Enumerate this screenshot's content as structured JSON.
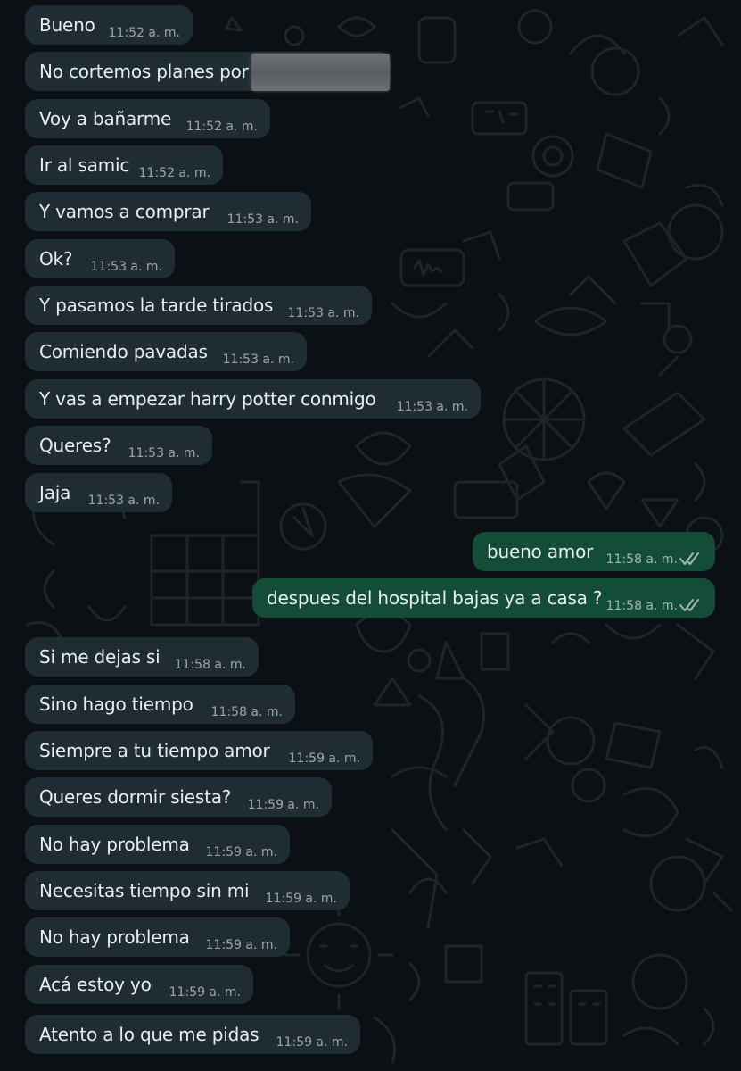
{
  "theme": {
    "wallpaper_bg": "#0b1014",
    "incoming_bubble": "#202c33",
    "outgoing_bubble": "#005c4b",
    "text_color": "#e9edef",
    "tick_color": "#a9b3b8"
  },
  "messages": [
    {
      "direction": "incoming",
      "text": "Bueno",
      "time": "11:52 a. m."
    },
    {
      "direction": "incoming",
      "text": "No cortemos planes por",
      "time": "",
      "redacted": true
    },
    {
      "direction": "incoming",
      "text": "Voy a bañarme",
      "time": "11:52 a. m."
    },
    {
      "direction": "incoming",
      "text": "Ir al samic",
      "time": "11:52 a. m."
    },
    {
      "direction": "incoming",
      "text": "Y vamos a comprar",
      "time": "11:53 a. m."
    },
    {
      "direction": "incoming",
      "text": "Ok?",
      "time": "11:53 a. m."
    },
    {
      "direction": "incoming",
      "text": "Y pasamos la tarde tirados",
      "time": "11:53 a. m."
    },
    {
      "direction": "incoming",
      "text": "Comiendo pavadas",
      "time": "11:53 a. m."
    },
    {
      "direction": "incoming",
      "text": "Y vas a empezar harry potter conmigo",
      "time": "11:53 a. m."
    },
    {
      "direction": "incoming",
      "text": "Queres?",
      "time": "11:53 a. m."
    },
    {
      "direction": "incoming",
      "text": "Jaja",
      "time": "11:53 a. m."
    },
    {
      "direction": "outgoing",
      "text": "bueno amor",
      "time": "11:58 a. m.",
      "status": "read"
    },
    {
      "direction": "outgoing",
      "text": "despues del hospital bajas ya a casa ?",
      "time": "11:58 a. m.",
      "status": "read"
    },
    {
      "direction": "incoming",
      "text": "Si me dejas si",
      "time": "11:58 a. m."
    },
    {
      "direction": "incoming",
      "text": "Sino hago tiempo",
      "time": "11:58 a. m."
    },
    {
      "direction": "incoming",
      "text": "Siempre a tu tiempo amor",
      "time": "11:59 a. m."
    },
    {
      "direction": "incoming",
      "text": "Queres dormir siesta?",
      "time": "11:59 a. m."
    },
    {
      "direction": "incoming",
      "text": "No hay problema",
      "time": "11:59 a. m."
    },
    {
      "direction": "incoming",
      "text": "Necesitas tiempo sin mi",
      "time": "11:59 a. m."
    },
    {
      "direction": "incoming",
      "text": "No hay problema",
      "time": "11:59 a. m."
    },
    {
      "direction": "incoming",
      "text": "Acá estoy yo",
      "time": "11:59 a. m."
    },
    {
      "direction": "incoming",
      "text": "Atento a lo que me pidas",
      "time": "11:59 a. m."
    }
  ],
  "icons": {
    "read_receipt": "double-check-icon",
    "wallpaper": "doodle-wallpaper"
  }
}
